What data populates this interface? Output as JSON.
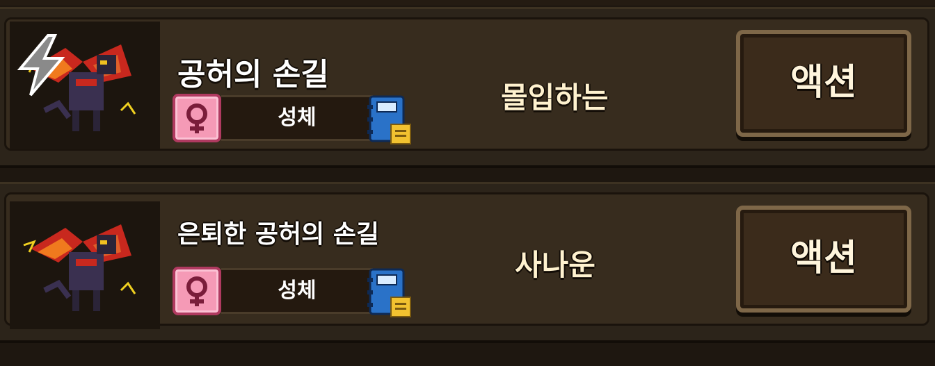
{
  "monsters": [
    {
      "name": "공허의 손길",
      "trait": "성체",
      "mood": "몰입하는",
      "action_label": "액션",
      "gender_icon": "female-symbol-icon",
      "book_icon": "journal-book-icon",
      "has_element_bolt": true
    },
    {
      "name": "은퇴한 공허의 손길",
      "trait": "성체",
      "mood": "사나운",
      "action_label": "액션",
      "gender_icon": "female-symbol-icon",
      "book_icon": "journal-book-icon",
      "has_element_bolt": false
    }
  ],
  "colors": {
    "background": "#1e1710",
    "card": "#372c1e",
    "gender_badge": "#f59ab6",
    "button_border": "#7e6748",
    "mood_text": "#fff2cf"
  }
}
